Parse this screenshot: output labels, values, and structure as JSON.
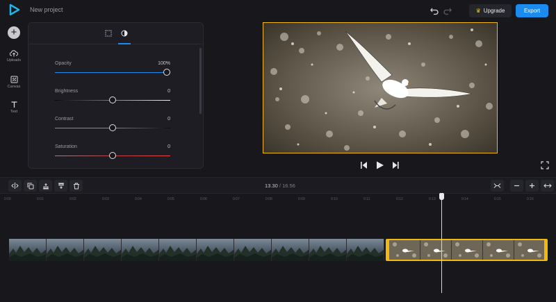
{
  "header": {
    "project_name": "New project",
    "upgrade_label": "Upgrade",
    "export_label": "Export"
  },
  "rail": {
    "items": [
      {
        "label": "Uploads",
        "icon": "cloud-upload-icon"
      },
      {
        "label": "Canvas",
        "icon": "canvas-icon"
      },
      {
        "label": "Text",
        "icon": "text-icon"
      }
    ]
  },
  "panel": {
    "tabs": [
      {
        "icon": "crop-grid-icon",
        "active": false
      },
      {
        "icon": "adjust-contrast-icon",
        "active": true
      }
    ],
    "sliders": [
      {
        "label": "Opacity",
        "value": "100%",
        "fraction": 1.0,
        "color": "#1a8cf0"
      },
      {
        "label": "Brightness",
        "value": "0",
        "fraction": 0.5,
        "color": "#e8e8ec"
      },
      {
        "label": "Contrast",
        "value": "0",
        "fraction": 0.5,
        "color": "#8a8a92"
      },
      {
        "label": "Saturation",
        "value": "0",
        "fraction": 0.5,
        "color": "#e0484a"
      }
    ]
  },
  "toolbar": {
    "current_time": "13.30",
    "separator": "/",
    "total_time": "16.56"
  },
  "ruler": {
    "ticks": [
      "0:00",
      "0:01",
      "0:02",
      "0:03",
      "0:04",
      "0:05",
      "0:06",
      "0:07",
      "0:08",
      "0:09",
      "0:10",
      "0:11",
      "0:12",
      "0:13",
      "0:14",
      "0:15",
      "0:16"
    ]
  },
  "colors": {
    "accent": "#1a8cf0",
    "selection": "#f0b90b",
    "background": "#17171c"
  }
}
